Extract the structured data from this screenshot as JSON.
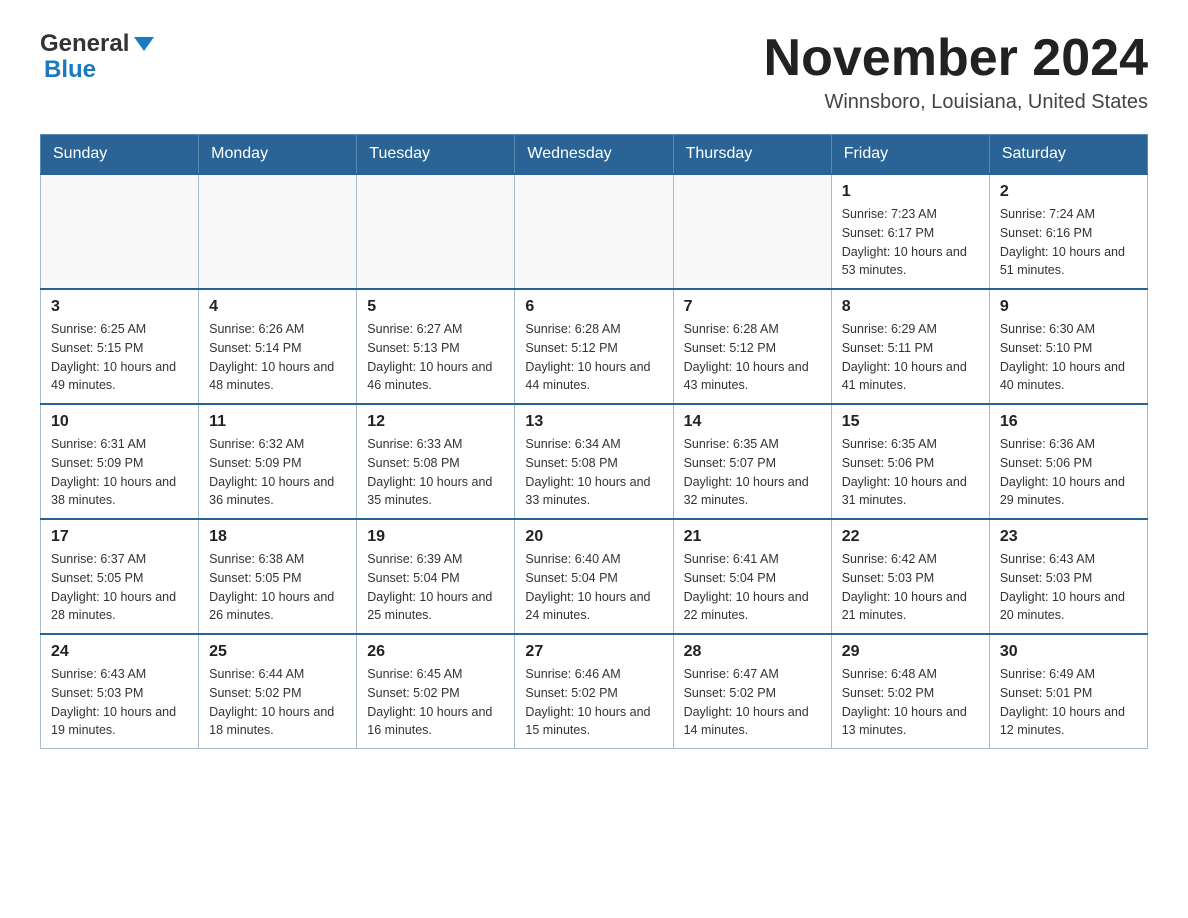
{
  "header": {
    "logo_general": "General",
    "logo_blue": "Blue",
    "month_title": "November 2024",
    "location": "Winnsboro, Louisiana, United States"
  },
  "days_of_week": [
    "Sunday",
    "Monday",
    "Tuesday",
    "Wednesday",
    "Thursday",
    "Friday",
    "Saturday"
  ],
  "weeks": [
    {
      "days": [
        {
          "num": "",
          "info": ""
        },
        {
          "num": "",
          "info": ""
        },
        {
          "num": "",
          "info": ""
        },
        {
          "num": "",
          "info": ""
        },
        {
          "num": "",
          "info": ""
        },
        {
          "num": "1",
          "info": "Sunrise: 7:23 AM\nSunset: 6:17 PM\nDaylight: 10 hours and 53 minutes."
        },
        {
          "num": "2",
          "info": "Sunrise: 7:24 AM\nSunset: 6:16 PM\nDaylight: 10 hours and 51 minutes."
        }
      ]
    },
    {
      "days": [
        {
          "num": "3",
          "info": "Sunrise: 6:25 AM\nSunset: 5:15 PM\nDaylight: 10 hours and 49 minutes."
        },
        {
          "num": "4",
          "info": "Sunrise: 6:26 AM\nSunset: 5:14 PM\nDaylight: 10 hours and 48 minutes."
        },
        {
          "num": "5",
          "info": "Sunrise: 6:27 AM\nSunset: 5:13 PM\nDaylight: 10 hours and 46 minutes."
        },
        {
          "num": "6",
          "info": "Sunrise: 6:28 AM\nSunset: 5:12 PM\nDaylight: 10 hours and 44 minutes."
        },
        {
          "num": "7",
          "info": "Sunrise: 6:28 AM\nSunset: 5:12 PM\nDaylight: 10 hours and 43 minutes."
        },
        {
          "num": "8",
          "info": "Sunrise: 6:29 AM\nSunset: 5:11 PM\nDaylight: 10 hours and 41 minutes."
        },
        {
          "num": "9",
          "info": "Sunrise: 6:30 AM\nSunset: 5:10 PM\nDaylight: 10 hours and 40 minutes."
        }
      ]
    },
    {
      "days": [
        {
          "num": "10",
          "info": "Sunrise: 6:31 AM\nSunset: 5:09 PM\nDaylight: 10 hours and 38 minutes."
        },
        {
          "num": "11",
          "info": "Sunrise: 6:32 AM\nSunset: 5:09 PM\nDaylight: 10 hours and 36 minutes."
        },
        {
          "num": "12",
          "info": "Sunrise: 6:33 AM\nSunset: 5:08 PM\nDaylight: 10 hours and 35 minutes."
        },
        {
          "num": "13",
          "info": "Sunrise: 6:34 AM\nSunset: 5:08 PM\nDaylight: 10 hours and 33 minutes."
        },
        {
          "num": "14",
          "info": "Sunrise: 6:35 AM\nSunset: 5:07 PM\nDaylight: 10 hours and 32 minutes."
        },
        {
          "num": "15",
          "info": "Sunrise: 6:35 AM\nSunset: 5:06 PM\nDaylight: 10 hours and 31 minutes."
        },
        {
          "num": "16",
          "info": "Sunrise: 6:36 AM\nSunset: 5:06 PM\nDaylight: 10 hours and 29 minutes."
        }
      ]
    },
    {
      "days": [
        {
          "num": "17",
          "info": "Sunrise: 6:37 AM\nSunset: 5:05 PM\nDaylight: 10 hours and 28 minutes."
        },
        {
          "num": "18",
          "info": "Sunrise: 6:38 AM\nSunset: 5:05 PM\nDaylight: 10 hours and 26 minutes."
        },
        {
          "num": "19",
          "info": "Sunrise: 6:39 AM\nSunset: 5:04 PM\nDaylight: 10 hours and 25 minutes."
        },
        {
          "num": "20",
          "info": "Sunrise: 6:40 AM\nSunset: 5:04 PM\nDaylight: 10 hours and 24 minutes."
        },
        {
          "num": "21",
          "info": "Sunrise: 6:41 AM\nSunset: 5:04 PM\nDaylight: 10 hours and 22 minutes."
        },
        {
          "num": "22",
          "info": "Sunrise: 6:42 AM\nSunset: 5:03 PM\nDaylight: 10 hours and 21 minutes."
        },
        {
          "num": "23",
          "info": "Sunrise: 6:43 AM\nSunset: 5:03 PM\nDaylight: 10 hours and 20 minutes."
        }
      ]
    },
    {
      "days": [
        {
          "num": "24",
          "info": "Sunrise: 6:43 AM\nSunset: 5:03 PM\nDaylight: 10 hours and 19 minutes."
        },
        {
          "num": "25",
          "info": "Sunrise: 6:44 AM\nSunset: 5:02 PM\nDaylight: 10 hours and 18 minutes."
        },
        {
          "num": "26",
          "info": "Sunrise: 6:45 AM\nSunset: 5:02 PM\nDaylight: 10 hours and 16 minutes."
        },
        {
          "num": "27",
          "info": "Sunrise: 6:46 AM\nSunset: 5:02 PM\nDaylight: 10 hours and 15 minutes."
        },
        {
          "num": "28",
          "info": "Sunrise: 6:47 AM\nSunset: 5:02 PM\nDaylight: 10 hours and 14 minutes."
        },
        {
          "num": "29",
          "info": "Sunrise: 6:48 AM\nSunset: 5:02 PM\nDaylight: 10 hours and 13 minutes."
        },
        {
          "num": "30",
          "info": "Sunrise: 6:49 AM\nSunset: 5:01 PM\nDaylight: 10 hours and 12 minutes."
        }
      ]
    }
  ]
}
